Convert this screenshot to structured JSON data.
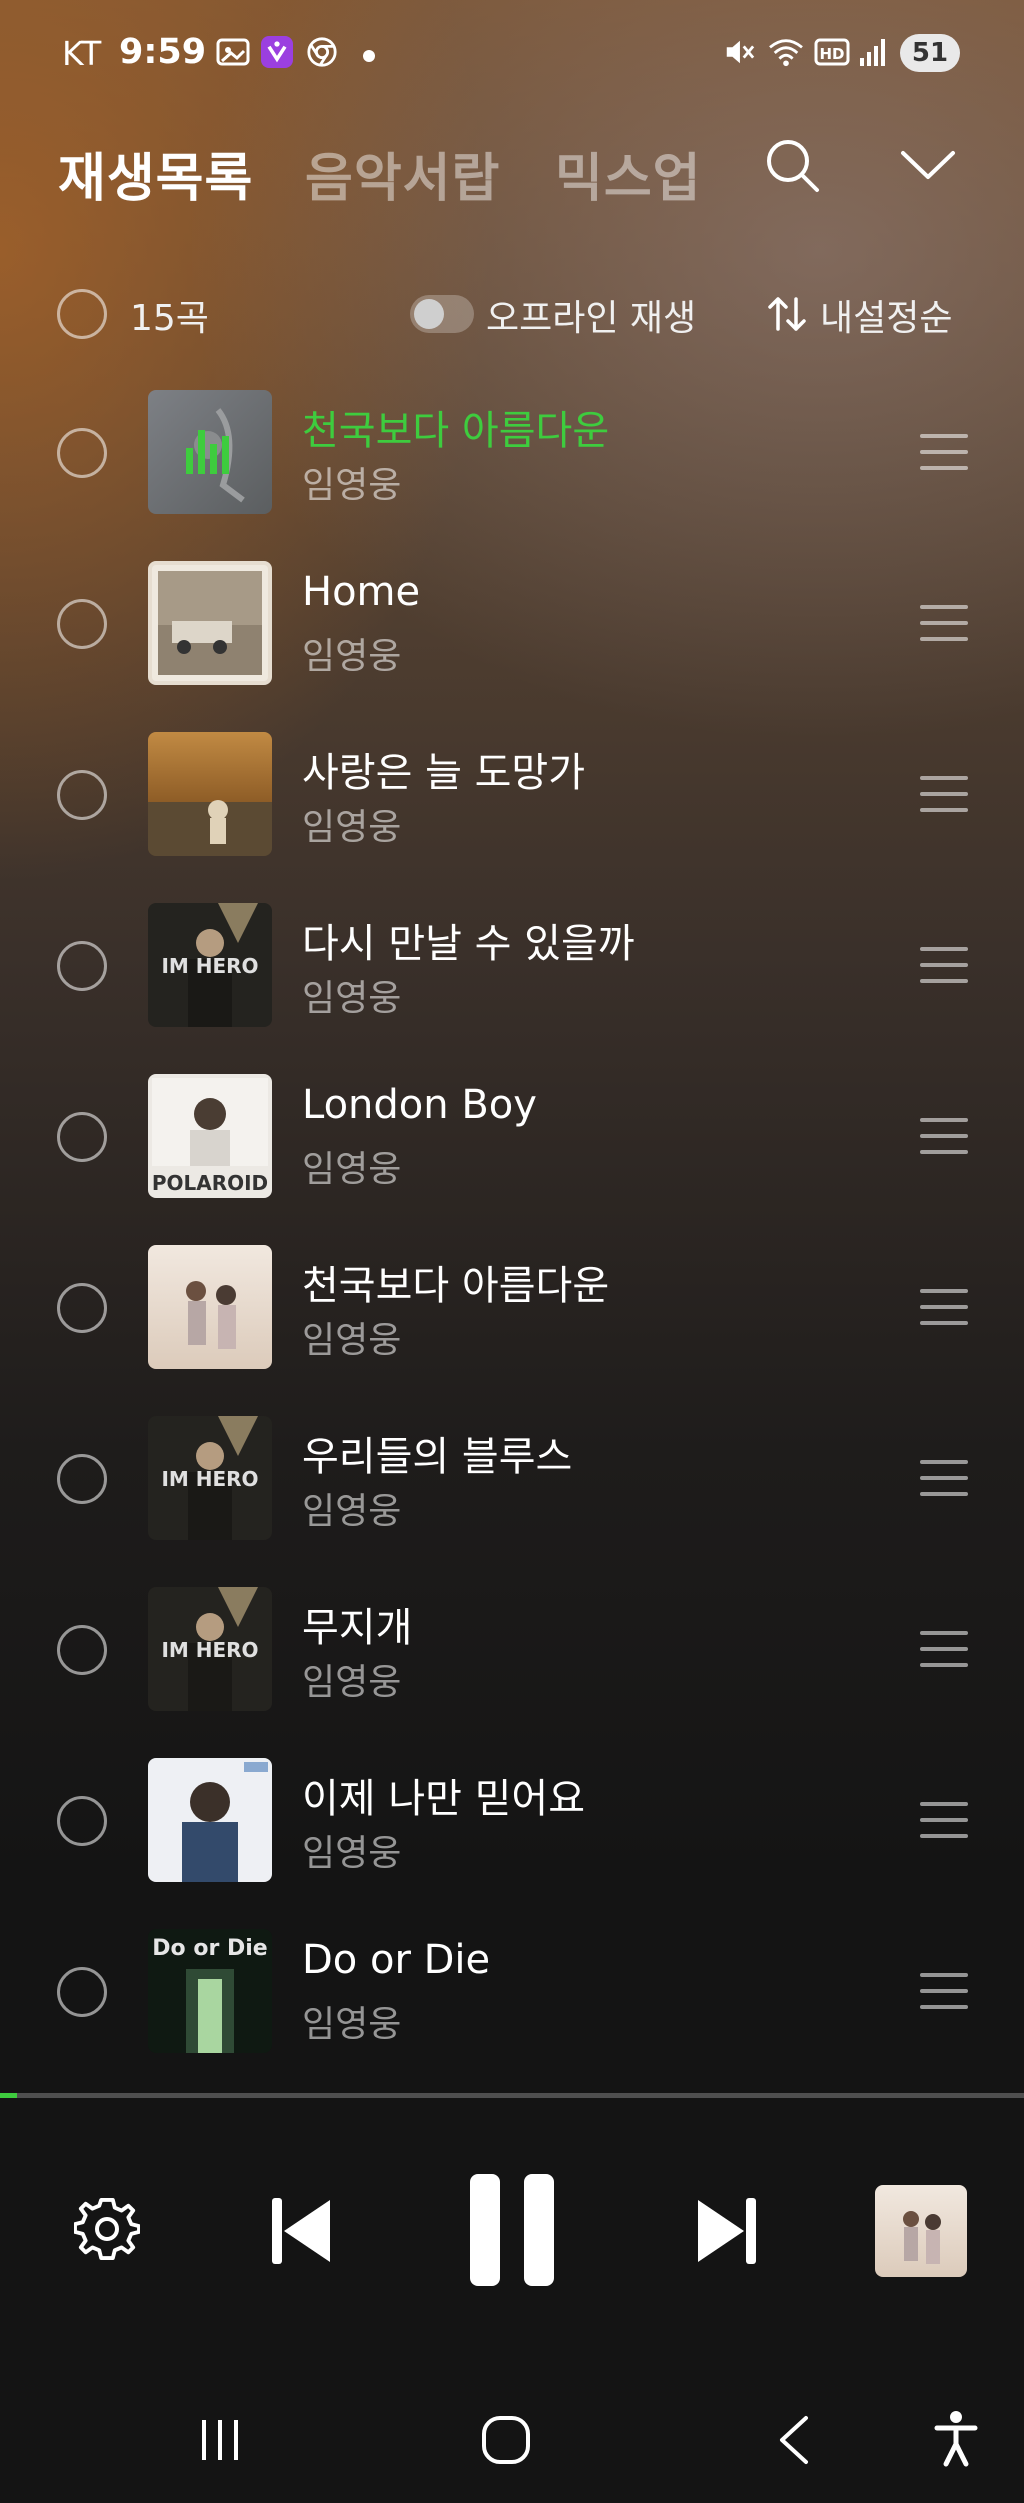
{
  "status_bar": {
    "carrier": "KT",
    "time": "9:59",
    "battery": "51",
    "icons": [
      "gallery-icon",
      "app-badge-icon",
      "chrome-icon",
      "dot-icon",
      "mute-icon",
      "wifi-icon",
      "hd-icon",
      "signal-icon",
      "battery-icon"
    ]
  },
  "header": {
    "tabs": [
      {
        "label": "재생목록",
        "active": true
      },
      {
        "label": "음악서랍",
        "active": false
      },
      {
        "label": "믹스업",
        "active": false
      }
    ],
    "icons": [
      "search-icon",
      "chevron-down-icon"
    ]
  },
  "toolbar": {
    "count": "15곡",
    "offline_label": "오프라인 재생",
    "offline_enabled": false,
    "sort_label": "내설정순"
  },
  "songs": [
    {
      "title": "천국보다 아름다운",
      "artist": "임영웅",
      "playing": true,
      "art_color": "#6f7377"
    },
    {
      "title": "Home",
      "artist": "임영웅",
      "playing": false,
      "art_color": "#b8a996"
    },
    {
      "title": "사랑은 늘 도망가",
      "artist": "임영웅",
      "playing": false,
      "art_color": "#a06a2d"
    },
    {
      "title": "다시 만날 수 있을까",
      "artist": "임영웅",
      "playing": false,
      "art_color": "#2c2a26"
    },
    {
      "title": "London Boy",
      "artist": "임영웅",
      "playing": false,
      "art_color": "#e6e2dc"
    },
    {
      "title": "천국보다 아름다운",
      "artist": "임영웅",
      "playing": false,
      "art_color": "#e8d9cd"
    },
    {
      "title": "우리들의 블루스",
      "artist": "임영웅",
      "playing": false,
      "art_color": "#2c2a26"
    },
    {
      "title": "무지개",
      "artist": "임영웅",
      "playing": false,
      "art_color": "#2c2a26"
    },
    {
      "title": "이제 나만 믿어요",
      "artist": "임영웅",
      "playing": false,
      "art_color": "#e9ecf2"
    },
    {
      "title": "Do or Die",
      "artist": "임영웅",
      "playing": false,
      "art_color": "#1d2a1f"
    }
  ],
  "thumb_texts": {
    "im_hero": "IM HERO",
    "polaroid": "POLAROID",
    "do_or_die": "Do or Die"
  },
  "player": {
    "progress": 0.017,
    "icons": [
      "settings-icon",
      "previous-icon",
      "pause-icon",
      "next-icon",
      "album-art"
    ]
  },
  "navbar": {
    "icons": [
      "recents-icon",
      "home-icon",
      "back-icon",
      "accessibility-icon"
    ]
  },
  "colors": {
    "accent": "#3ecc3e",
    "background": "#141414"
  }
}
